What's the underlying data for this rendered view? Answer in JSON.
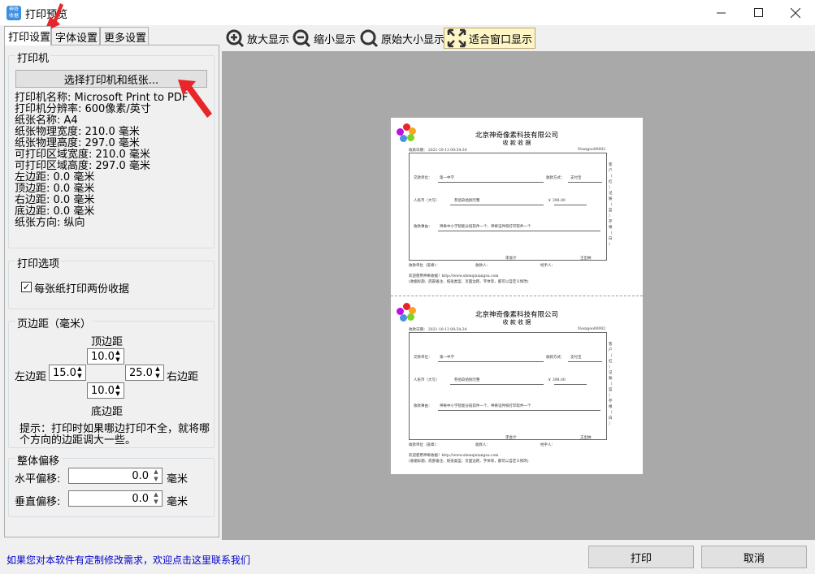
{
  "window": {
    "title": "打印预览",
    "app_icon_text": "神奇\n收据"
  },
  "tabs": [
    "打印设置",
    "字体设置",
    "更多设置"
  ],
  "printer_group": {
    "title": "打印机",
    "select_button": "选择打印机和纸张...",
    "info": [
      "打印机名称: Microsoft Print to PDF",
      "打印机分辨率: 600像素/英寸",
      "纸张名称: A4",
      "纸张物理宽度: 210.0 毫米",
      "纸张物理高度: 297.0 毫米",
      "可打印区域宽度: 210.0 毫米",
      "可打印区域高度: 297.0 毫米",
      "左边距: 0.0 毫米",
      "顶边距: 0.0 毫米",
      "右边距: 0.0 毫米",
      "底边距: 0.0 毫米",
      "纸张方向: 纵向"
    ]
  },
  "print_options": {
    "title": "打印选项",
    "two_copies_label": "每张纸打印两份收据",
    "two_copies_checked": true
  },
  "margins": {
    "title": "页边距（毫米）",
    "top_label": "顶边距",
    "top_value": "10.0",
    "left_label": "左边距",
    "left_value": "15.0",
    "right_label": "右边距",
    "right_value": "25.0",
    "bottom_label": "底边距",
    "bottom_value": "10.0",
    "hint": "提示：打印时如果哪边打印不全，就将哪个方向的边距调大一些。",
    "hint_line1": "提示：打印时如果哪边打印不全，就将哪",
    "hint_line2": "个方向的边距调大一些。"
  },
  "offset": {
    "title": "整体偏移",
    "horizontal_label": "水平偏移:",
    "horizontal_value": "0.0",
    "vertical_label": "垂直偏移:",
    "vertical_value": "0.0",
    "unit": "毫米"
  },
  "toolbar": {
    "zoom_in": "放大显示",
    "zoom_out": "缩小显示",
    "actual_size": "原始大小显示",
    "fit_window": "适合窗口显示"
  },
  "receipt": {
    "company": "北京神奇像素科技有限公司",
    "title": "收 款 收 据",
    "date": "收款日期：  2021-10-13 09:54:34",
    "number": "Nosxgoo00002",
    "payer_label": "交款单位：",
    "payer_value": "第一中学",
    "method_label": "收款方式：",
    "method_value": "支付宝",
    "amount_cn_label": "人民币（大写）",
    "amount_cn_value": "叁佰玖拾捌元整",
    "amount_num": "￥  398.00",
    "reason_label": "收款事由：",
    "reason_value": "神奇中小学智能分班软件一个、神奇证件照打印软件一个",
    "accountant": "李会计",
    "manager": "王出纳",
    "sign_unit": "收款单位（盖章）：",
    "sign_receiver": "收款人：",
    "sign_handler": "经手人：",
    "side_text": "客户（红）记账（蓝）存根（白）",
    "footer1": "欢迎使用神奇收据！http://www.shenqixiangsu.com",
    "footer2": "(收据标题、底部备注、纸张类型、页面边距、字体等，都可以自定义修改)"
  },
  "bottom": {
    "custom_link": "如果您对本软件有定制修改需求，欢迎点击这里联系我们",
    "print_button": "打印",
    "cancel_button": "取消"
  },
  "colors": {
    "link": "#0000cc",
    "annotation_arrow": "#e8262a",
    "fit_button_bg": "#fff6c8",
    "preview_bg": "#a9a9a9"
  }
}
